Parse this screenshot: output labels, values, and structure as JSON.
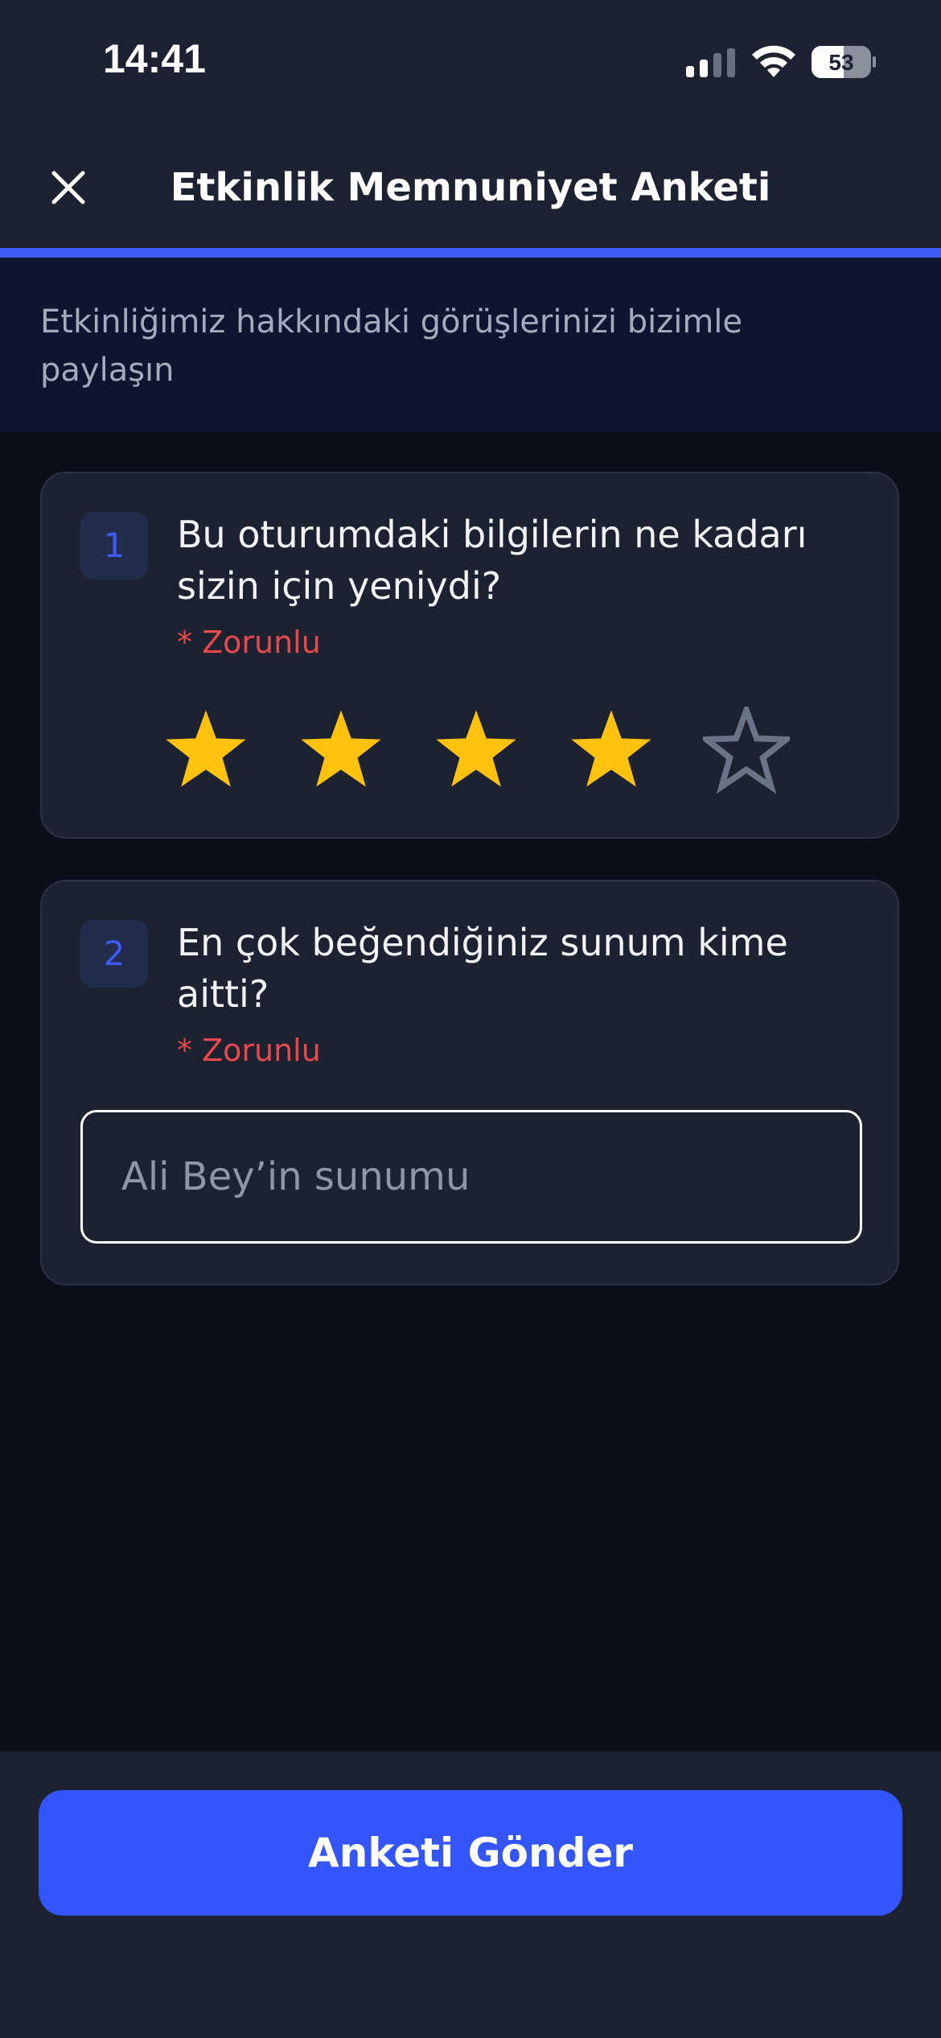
{
  "status_bar": {
    "time": "14:41",
    "battery": "53"
  },
  "header": {
    "title": "Etkinlik Memnuniyet Anketi",
    "close_icon": "close-icon"
  },
  "progress": {
    "fraction": 1.0
  },
  "subtitle": "Etkinliğimiz hakkındaki görüşlerinizi bizimle paylaşın",
  "questions": [
    {
      "number": "1",
      "text": "Bu oturumdaki bilgilerin ne kadarı sizin için yeniydi?",
      "required_label": "* Zorunlu",
      "type": "rating",
      "rating": 4,
      "max_rating": 5
    },
    {
      "number": "2",
      "text": "En çok beğendiğiniz sunum kime aitti?",
      "required_label": "* Zorunlu",
      "type": "text",
      "value": "Ali Bey’in sunumu"
    }
  ],
  "submit_label": "Anketi Gönder",
  "colors": {
    "accent": "#3355fb",
    "star_filled": "#ffc20e",
    "star_empty": "#6b7386",
    "required": "#e5484d"
  }
}
